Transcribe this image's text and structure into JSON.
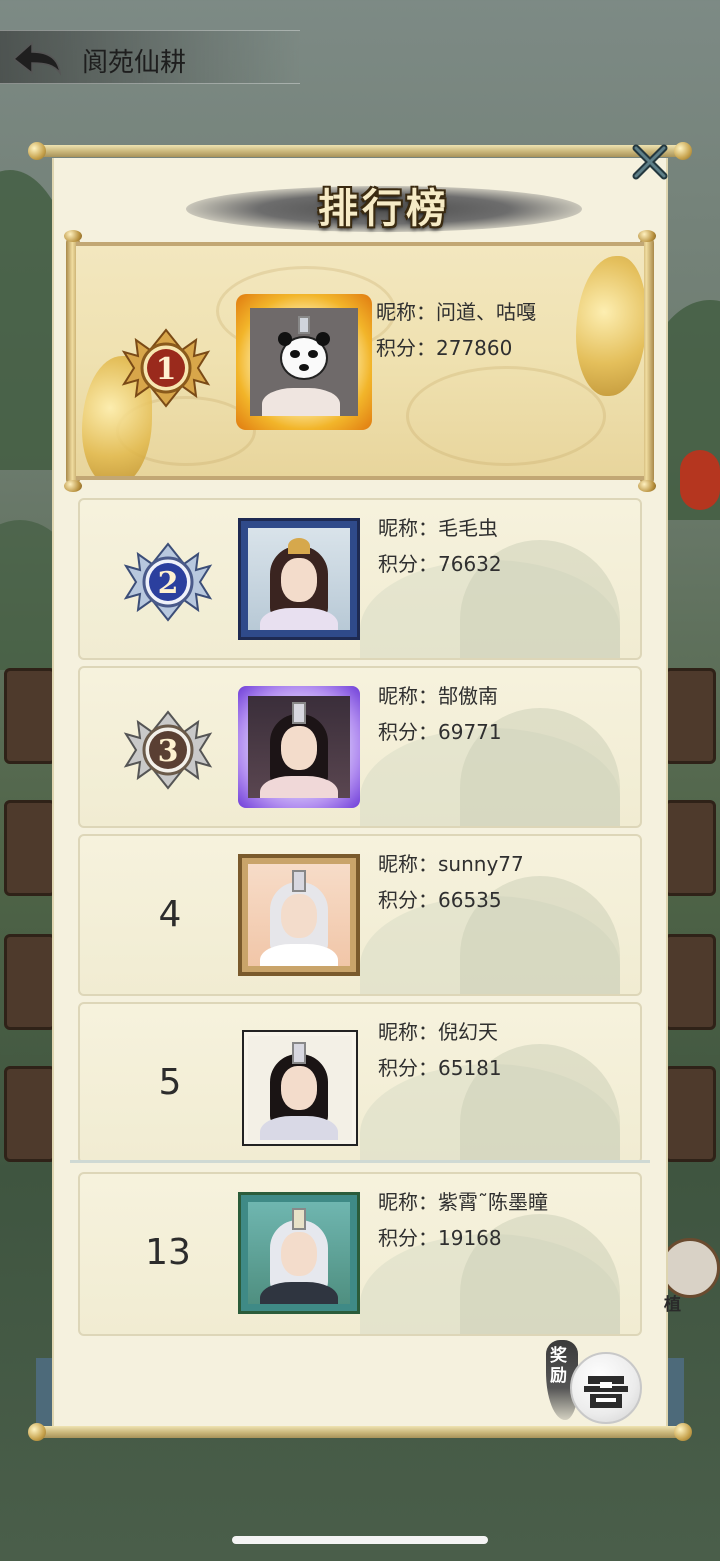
{
  "app": {
    "title": "阆苑仙耕",
    "side_tag": "植"
  },
  "dialog": {
    "title": "排行榜",
    "close_icon": "close-x-icon"
  },
  "leaderboard": {
    "label_nickname": "昵称：",
    "label_score": "积分：",
    "top": {
      "rank": "1",
      "nickname": "问道、咕嘎",
      "score": "277860"
    },
    "entries": [
      {
        "rank": "2",
        "nickname": "毛毛虫",
        "score": "76632"
      },
      {
        "rank": "3",
        "nickname": "郜傲南",
        "score": "69771"
      },
      {
        "rank": "4",
        "nickname": "sunny77",
        "score": "66535"
      },
      {
        "rank": "5",
        "nickname": "倪幻天",
        "score": "65181"
      }
    ],
    "self": {
      "rank": "13",
      "nickname": "紫霄˜陈墨瞳",
      "score": "19168"
    }
  },
  "reward": {
    "label": "奖励",
    "icon": "treasure-chest-icon"
  },
  "colors": {
    "panel_bg": "#f5f1de",
    "gold": "#e2b94c",
    "medal_gold": "#b22f24",
    "medal_silver": "#2b3f9e",
    "medal_bronze": "#5a3f33"
  }
}
